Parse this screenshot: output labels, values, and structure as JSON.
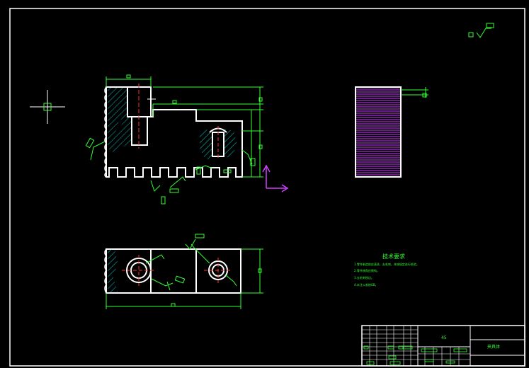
{
  "drawing": {
    "tech_requirements": {
      "title": "技术要求",
      "lines": [
        "1.零件制造前应清洗、去毛刺，并按规定进行检验。",
        "2.零件棱角应倒钝。",
        "3.去毛刺锐边。",
        "4.未注公差按GB。"
      ]
    },
    "title_block": {
      "material": "45",
      "part_name": "夹具体"
    }
  }
}
